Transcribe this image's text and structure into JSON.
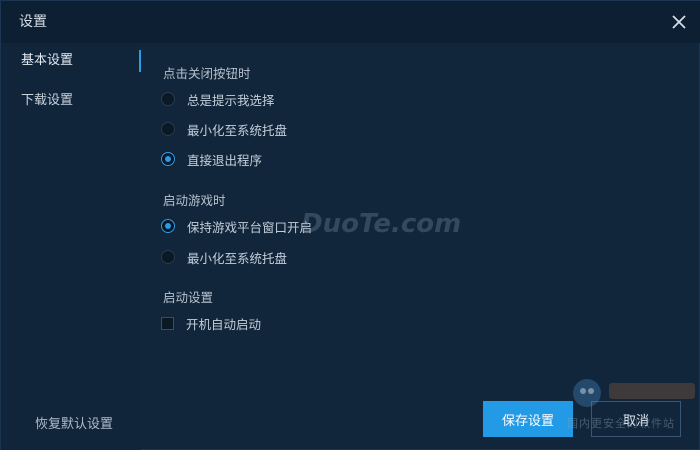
{
  "window": {
    "title": "设置"
  },
  "sidebar": {
    "items": [
      {
        "label": "基本设置",
        "active": true
      },
      {
        "label": "下载设置",
        "active": false
      }
    ],
    "restore_label": "恢复默认设置"
  },
  "sections": {
    "close_behavior": {
      "title": "点击关闭按钮时",
      "options": [
        {
          "label": "总是提示我选择",
          "checked": false
        },
        {
          "label": "最小化至系统托盘",
          "checked": false
        },
        {
          "label": "直接退出程序",
          "checked": true
        }
      ]
    },
    "game_launch": {
      "title": "启动游戏时",
      "options": [
        {
          "label": "保持游戏平台窗口开启",
          "checked": true
        },
        {
          "label": "最小化至系统托盘",
          "checked": false
        }
      ]
    },
    "startup": {
      "title": "启动设置",
      "checkbox_label": "开机自动启动",
      "checked": false
    }
  },
  "footer": {
    "save_label": "保存设置",
    "cancel_label": "取消"
  },
  "watermark": {
    "site": "DuoTe.com",
    "tagline": "国内更安全的软件站"
  },
  "colors": {
    "accent": "#239ae6",
    "background": "#10243a",
    "titlebar": "#0d1f33"
  },
  "icons": {
    "close": "close-icon"
  }
}
